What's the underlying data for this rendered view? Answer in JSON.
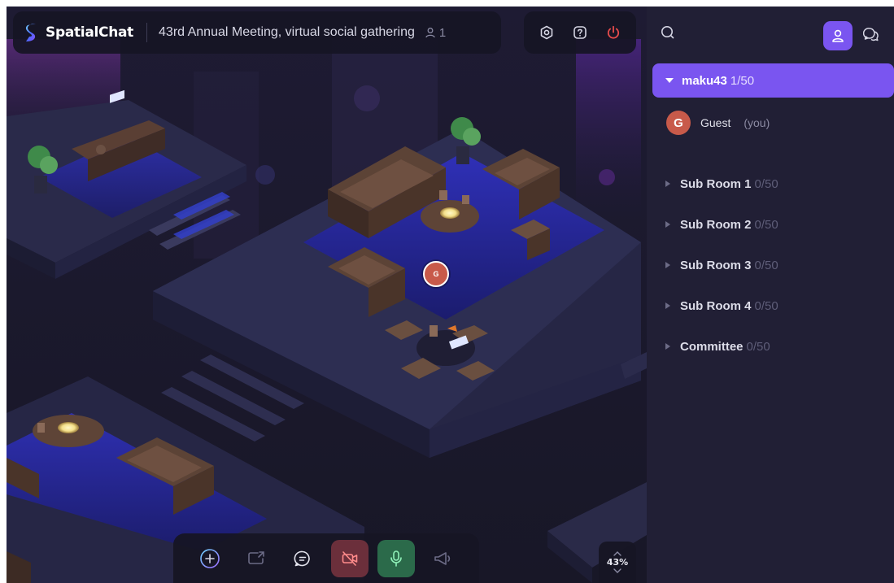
{
  "app": {
    "name": "SpatialChat",
    "meeting_title": "43rd Annual Meeting, virtual social gathering",
    "participant_count": "1"
  },
  "canvas": {
    "self_avatar_initial": "G"
  },
  "zoom": {
    "level": "43%"
  },
  "sidebar": {
    "active_room": {
      "name": "maku43",
      "count": "1/50"
    },
    "members": [
      {
        "initial": "G",
        "name": "Guest",
        "suffix": "(you)"
      }
    ],
    "rooms": [
      {
        "name": "Sub Room 1",
        "count": "0/50"
      },
      {
        "name": "Sub Room 2",
        "count": "0/50"
      },
      {
        "name": "Sub Room 3",
        "count": "0/50"
      },
      {
        "name": "Sub Room 4",
        "count": "0/50"
      },
      {
        "name": "Committee",
        "count": "0/50"
      }
    ]
  },
  "colors": {
    "accent": "#7a55f0",
    "camera_off": "#6b2f3b",
    "mic_on": "#2b6a4a",
    "avatar": "#c85a4a",
    "leave": "#e84c4c"
  },
  "icons": {
    "topbar": [
      "settings-icon",
      "help-icon",
      "power-icon"
    ],
    "toolbar": [
      "add-icon",
      "share-screen-icon",
      "chat-icon",
      "camera-off-icon",
      "microphone-icon",
      "megaphone-icon"
    ],
    "sidebar": [
      "search-icon",
      "people-icon",
      "chat-bubble-icon"
    ]
  }
}
